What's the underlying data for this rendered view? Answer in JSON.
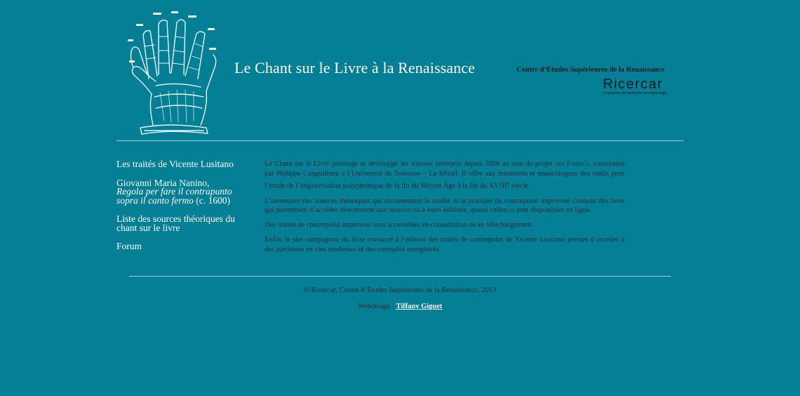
{
  "header": {
    "site_title": "Le Chant sur le Livre à la Renaissance",
    "institution": "Centre d’Études Supérieures de la Renaissance",
    "ricercar_name": "Ricercar",
    "ricercar_tagline": "Programme de recherche en musicologie"
  },
  "nav": {
    "item1": "Les traités de Vicente Lusitano",
    "item2_author": "Giovanni Maria Nanino,",
    "item2_title": "Regola per fare il contrapunto sopra il canto fermo",
    "item2_date": "(c. 1600)",
    "item3": "Liste des sources théoriques du chant sur le livre",
    "item4": "Forum"
  },
  "content": {
    "p1_a": "Le Chant sur le Livre prolonge et développe les travaux entrepris depuis 2008 au sein du projet ",
    "p1_project": "ars Fabrica",
    "p1_b": ", coordonné par Philippe Canguilhem à l’Université de Toulouse – Le Mirail. Il offre aux musiciens et musicologues des outils pour l’étude de l’improvisation polyphonique de la fin du Moyen Âge à la fin du XVIII",
    "p1_sup": "e",
    "p1_c": " siècle.",
    "p2": "L’inventaire des sources théoriques qui documentent la réalité et la pratique du contrepoint improvisé contient des liens qui permettent d’accéder directement aux sources ou à leurs éditions, quand celles-ci sont disponibles en ligne.",
    "p3": "Des traités de contrepoint improvisé sont accessibles en consultation ou en téléchargement.",
    "p4": "Enfin, le site compagnon du livre consacré à l’édition des traités de contrepoint de Vicente Lusitano permet d’accéder à des partitions en clés modernes et des exemples enregistrés."
  },
  "footer": {
    "copyright": "© Ricercar, Centre d’Études Supérieures de la Renaissance, 2013",
    "webdesign_label": "Webdesign :",
    "designer": "Tiffany Giguet"
  },
  "colors": {
    "background": "#057f96",
    "text_dark": "#0a2a30",
    "link_light": "#ffffff",
    "rule": "#9fd0da"
  }
}
